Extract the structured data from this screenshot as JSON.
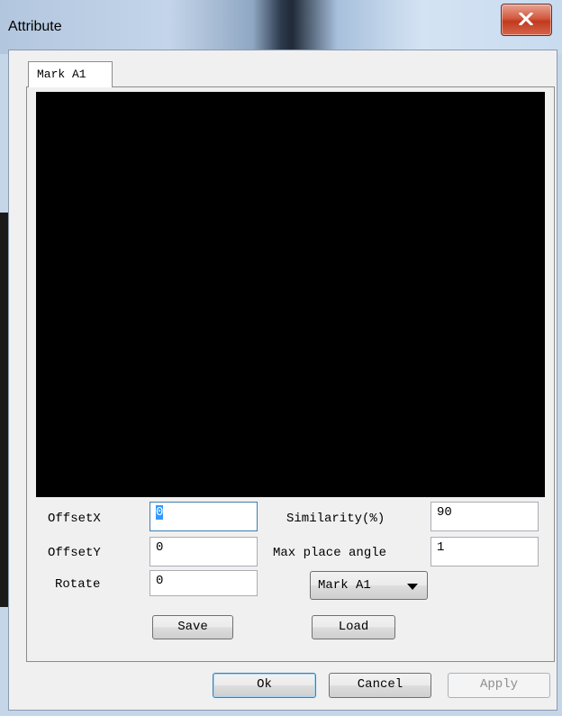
{
  "window": {
    "title": "Attribute"
  },
  "tabs": [
    {
      "label": "Mark A1"
    }
  ],
  "fields": {
    "offset_x": {
      "label": "OffsetX",
      "value": "0"
    },
    "offset_y": {
      "label": "OffsetY",
      "value": "0"
    },
    "rotate": {
      "label": "Rotate",
      "value": "0"
    },
    "similarity": {
      "label": "Similarity(%)",
      "value": "90"
    },
    "max_place_angle": {
      "label": "Max place angle",
      "value": "1"
    }
  },
  "mark_select": {
    "value": "Mark A1"
  },
  "buttons": {
    "save": "Save",
    "load": "Load",
    "ok": "Ok",
    "cancel": "Cancel",
    "apply": "Apply"
  },
  "colors": {
    "view_background": "#000000",
    "close_button": "#c23a1f"
  },
  "icons": {
    "close": "close-x-icon",
    "dropdown": "triangle-down-icon"
  }
}
